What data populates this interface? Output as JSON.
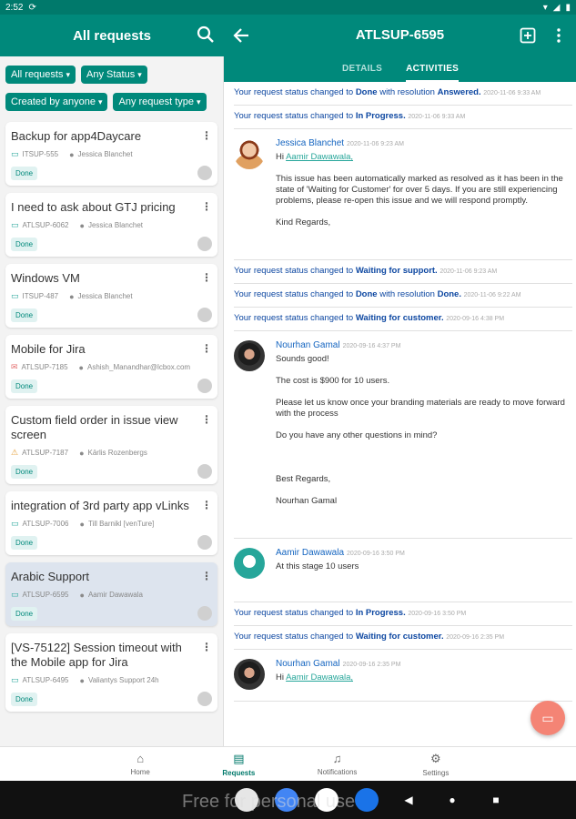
{
  "status": {
    "time": "2:52",
    "battery": "▮"
  },
  "left_header": {
    "title": "All requests"
  },
  "filters": {
    "row1": [
      "All requests",
      "Any Status"
    ],
    "row2": [
      "Created by anyone",
      "Any request type"
    ]
  },
  "requests": [
    {
      "title": "Backup for app4Daycare",
      "key": "ITSUP-555",
      "person": "Jessica Blanchet",
      "status": "Done",
      "type_icon": "request-icon"
    },
    {
      "title": "I need to ask about GTJ pricing",
      "key": "ATLSUP-6062",
      "person": "Jessica Blanchet",
      "status": "Done",
      "type_icon": "request-icon"
    },
    {
      "title": "Windows VM",
      "key": "ITSUP-487",
      "person": "Jessica Blanchet",
      "status": "Done",
      "type_icon": "request-icon"
    },
    {
      "title": "Mobile for Jira",
      "key": "ATLSUP-7185",
      "person": "Ashish_Manandhar@lcbox.com",
      "status": "Done",
      "type_icon": "mail-icon"
    },
    {
      "title": "Custom field order in issue view screen",
      "key": "ATLSUP-7187",
      "person": "Kārlis Rozenbergs",
      "status": "Done",
      "type_icon": "warning-icon"
    },
    {
      "title": "integration of 3rd party app vLinks",
      "key": "ATLSUP-7006",
      "person": "Till Barnikl [venTure]",
      "status": "Done",
      "type_icon": "request-icon"
    },
    {
      "title": "Arabic Support",
      "key": "ATLSUP-6595",
      "person": "Aamir Dawawala",
      "status": "Done",
      "type_icon": "request-icon",
      "selected": true
    },
    {
      "title": "[VS-75122] Session timeout with the Mobile app for Jira",
      "key": "ATLSUP-6495",
      "person": "Valiantys Support 24h",
      "status": "Done",
      "type_icon": "request-icon"
    }
  ],
  "detail": {
    "title": "ATLSUP-6595",
    "tabs": [
      "DETAILS",
      "ACTIVITIES"
    ],
    "activities": {
      "s1": {
        "prefix": "Your request status changed to ",
        "state": "Done",
        "mid": " with resolution ",
        "resolution": "Answered.",
        "ts": "2020-11-06 9:33 AM"
      },
      "s2": {
        "prefix": "Your request status changed to ",
        "state": "In Progress.",
        "ts": "2020-11-06 9:33 AM"
      },
      "c1": {
        "author": "Jessica Blanchet",
        "ts": "2020-11-06 9:23 AM",
        "greeting": "Hi ",
        "mention": "Aamir Dawawala,",
        "p1": "This issue has been automatically marked as resolved as it has been in the state of 'Waiting for Customer' for over 5 days. If you are still experiencing problems, please re-open this issue and we will respond promptly.",
        "p2": "Kind Regards,"
      },
      "s3": {
        "prefix": "Your request status changed to ",
        "state": "Waiting for support.",
        "ts": "2020-11-06 9:23 AM"
      },
      "s4": {
        "prefix": "Your request status changed to ",
        "state": "Done",
        "mid": " with resolution ",
        "resolution": "Done.",
        "ts": "2020-11-06 9:22 AM"
      },
      "s5": {
        "prefix": "Your request status changed to ",
        "state": "Waiting for customer.",
        "ts": "2020-09-16 4:38 PM"
      },
      "c2": {
        "author": "Nourhan Gamal",
        "ts": "2020-09-16 4:37 PM",
        "p0": "Sounds good!",
        "p1": "The cost is $900 for 10 users.",
        "p2": "Please let us know once your branding materials are ready to move forward with the process",
        "p3": "Do you have any other questions in mind?",
        "p4": "Best Regards,",
        "p5": "Nourhan Gamal"
      },
      "c3": {
        "author": "Aamir Dawawala",
        "ts": "2020-09-16 3:50 PM",
        "p0": "At this stage 10 users"
      },
      "s6": {
        "prefix": "Your request status changed to ",
        "state": "In Progress.",
        "ts": "2020-09-16 3:50 PM"
      },
      "s7": {
        "prefix": "Your request status changed to ",
        "state": "Waiting for customer.",
        "ts": "2020-09-16 2:35 PM"
      },
      "c4": {
        "author": "Nourhan Gamal",
        "ts": "2020-09-16 2:35 PM",
        "greeting": "Hi ",
        "mention": "Aamir Dawawala,"
      }
    }
  },
  "bottom_nav": [
    "Home",
    "Requests",
    "Notifications",
    "Settings"
  ],
  "watermark": "Free for personal use",
  "colors": {
    "primary": "#00897b",
    "accent": "#f48475",
    "link": "#0d47a1"
  }
}
